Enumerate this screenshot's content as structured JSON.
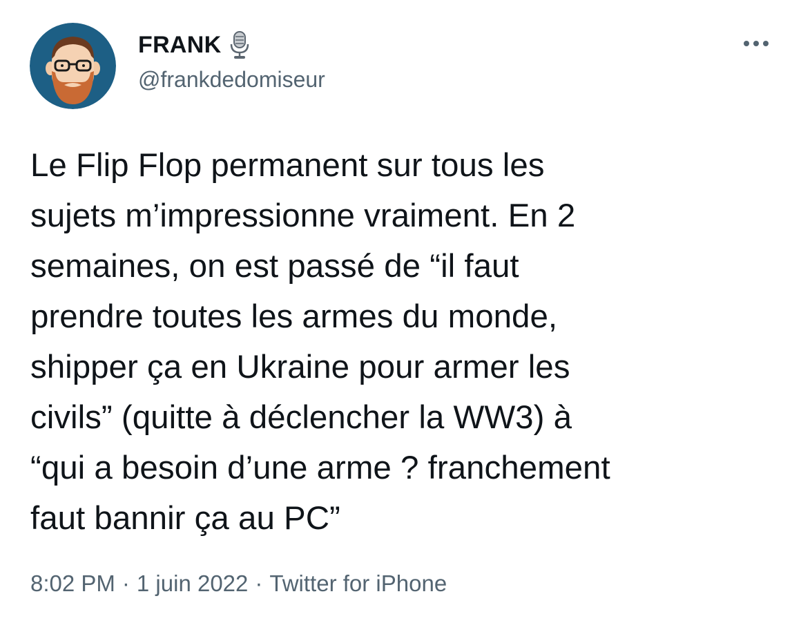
{
  "author": {
    "display_name": "FRANK",
    "handle": "@frankdedomiseur",
    "badge_icon": "microphone-icon",
    "avatar_bg": "#1d5f85"
  },
  "more_label": "•••",
  "tweet": {
    "lines": [
      "Le Flip Flop permanent sur tous les",
      "sujets m’impressionne vraiment. En 2",
      "semaines, on est passé de “il faut",
      "prendre toutes les armes du monde,",
      "shipper ça en Ukraine pour armer les",
      "civils” (quitte à déclencher la WW3) à",
      "“qui a besoin d’une arme ? franchement",
      "faut bannir ça au PC”"
    ]
  },
  "meta": {
    "time": "8:02 PM",
    "separator": "·",
    "date": "1 juin 2022",
    "source": "Twitter for iPhone"
  }
}
